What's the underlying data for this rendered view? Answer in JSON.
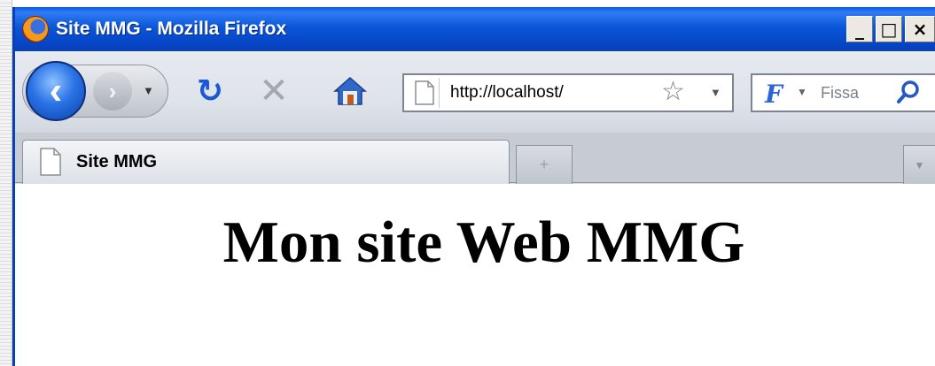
{
  "window": {
    "title": "Site MMG - Mozilla Firefox",
    "controls": {
      "minimize": "_",
      "maximize": "□",
      "close": "×"
    }
  },
  "toolbar": {
    "back_icon": "‹",
    "forward_icon": "›",
    "reload_icon": "↻",
    "stop_icon": "✕",
    "url": "http://localhost/",
    "bookmark_icon": "☆",
    "search_engine_letter": "F",
    "search_placeholder": "Fissa"
  },
  "tabs": [
    {
      "label": "Site MMG",
      "active": true
    }
  ],
  "newtab_symbol": "+",
  "page": {
    "heading": "Mon site Web MMG"
  },
  "colors": {
    "titlebar": "#0a56d8",
    "back_button": "#2a73e6",
    "reload": "#1a58d6"
  }
}
